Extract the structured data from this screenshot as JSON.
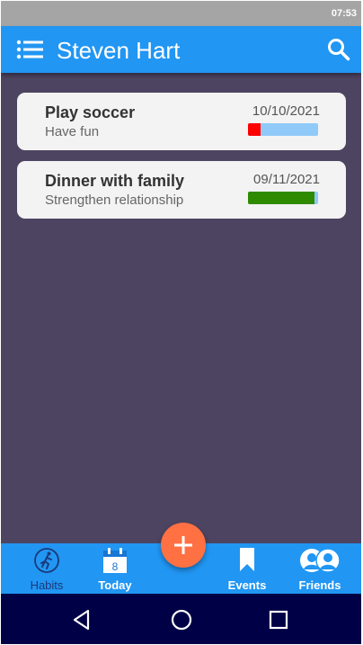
{
  "status_bar": {
    "time": "07:53"
  },
  "app_bar": {
    "title": "Steven Hart",
    "menu_icon": "hamburger-menu-icon",
    "search_icon": "search-icon"
  },
  "events": [
    {
      "title": "Play soccer",
      "subtitle": "Have fun",
      "date": "10/10/2021",
      "progress": 0.18,
      "progress_color": "#ff0000"
    },
    {
      "title": "Dinner with family",
      "subtitle": "Strengthen relationship",
      "date": "09/11/2021",
      "progress": 0.95,
      "progress_color": "#2e8b00"
    }
  ],
  "bottom_nav": {
    "items": [
      {
        "label": "Habits",
        "icon": "runner-icon",
        "active": true
      },
      {
        "label": "Today",
        "icon": "calendar-icon",
        "day": "8"
      },
      {
        "label": "Events",
        "icon": "bookmark-icon"
      },
      {
        "label": "Friends",
        "icon": "friends-icon"
      }
    ]
  },
  "fab": {
    "icon": "plus-icon"
  },
  "system_nav": {
    "back_icon": "back-triangle-icon",
    "home_icon": "home-circle-icon",
    "recents_icon": "recents-square-icon"
  },
  "colors": {
    "primary": "#2196f3",
    "background": "#4d4461",
    "fab": "#ff7043",
    "progress_track": "#90caf9",
    "system_nav": "#000046",
    "status_bar": "#a5a5a5"
  }
}
